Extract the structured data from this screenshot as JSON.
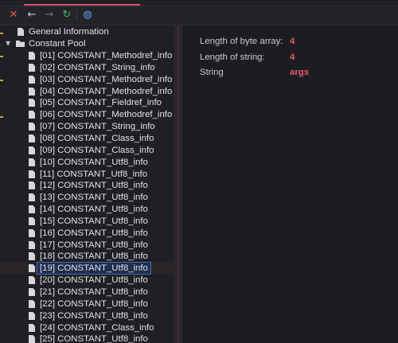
{
  "toolbar": {
    "buttons": [
      {
        "name": "close",
        "icon": "close-icon",
        "glyph": "✕"
      },
      {
        "name": "back",
        "icon": "arrow-left-icon",
        "glyph": "←"
      },
      {
        "name": "forward",
        "icon": "arrow-right-icon",
        "glyph": "→"
      },
      {
        "name": "refresh",
        "icon": "refresh-icon",
        "glyph": "↻"
      },
      {
        "name": "web",
        "icon": "globe-icon",
        "glyph": "◍"
      }
    ]
  },
  "tree": {
    "general_information": "General Information",
    "constant_pool": "Constant Pool",
    "items": [
      "[01] CONSTANT_Methodref_info",
      "[02] CONSTANT_String_info",
      "[03] CONSTANT_Methodref_info",
      "[04] CONSTANT_Methodref_info",
      "[05] CONSTANT_Fieldref_info",
      "[06] CONSTANT_Methodref_info",
      "[07] CONSTANT_String_info",
      "[08] CONSTANT_Class_info",
      "[09] CONSTANT_Class_info",
      "[10] CONSTANT_Utf8_info",
      "[11] CONSTANT_Utf8_info",
      "[12] CONSTANT_Utf8_info",
      "[13] CONSTANT_Utf8_info",
      "[14] CONSTANT_Utf8_info",
      "[15] CONSTANT_Utf8_info",
      "[16] CONSTANT_Utf8_info",
      "[17] CONSTANT_Utf8_info",
      "[18] CONSTANT_Utf8_info",
      "[19] CONSTANT_Utf8_info",
      "[20] CONSTANT_Utf8_info",
      "[21] CONSTANT_Utf8_info",
      "[22] CONSTANT_Utf8_info",
      "[23] CONSTANT_Utf8_info",
      "[24] CONSTANT_Class_info",
      "[25] CONSTANT_Utf8_info"
    ],
    "selected_index": 18
  },
  "details": [
    {
      "key": "Length of byte array:",
      "value": "4"
    },
    {
      "key": "Length of string:",
      "value": "4"
    },
    {
      "key": "String",
      "value": "args"
    }
  ],
  "colors": {
    "accent": "#e0506b",
    "value_text": "#e45c6a",
    "selection_border": "#3d6bc4"
  }
}
